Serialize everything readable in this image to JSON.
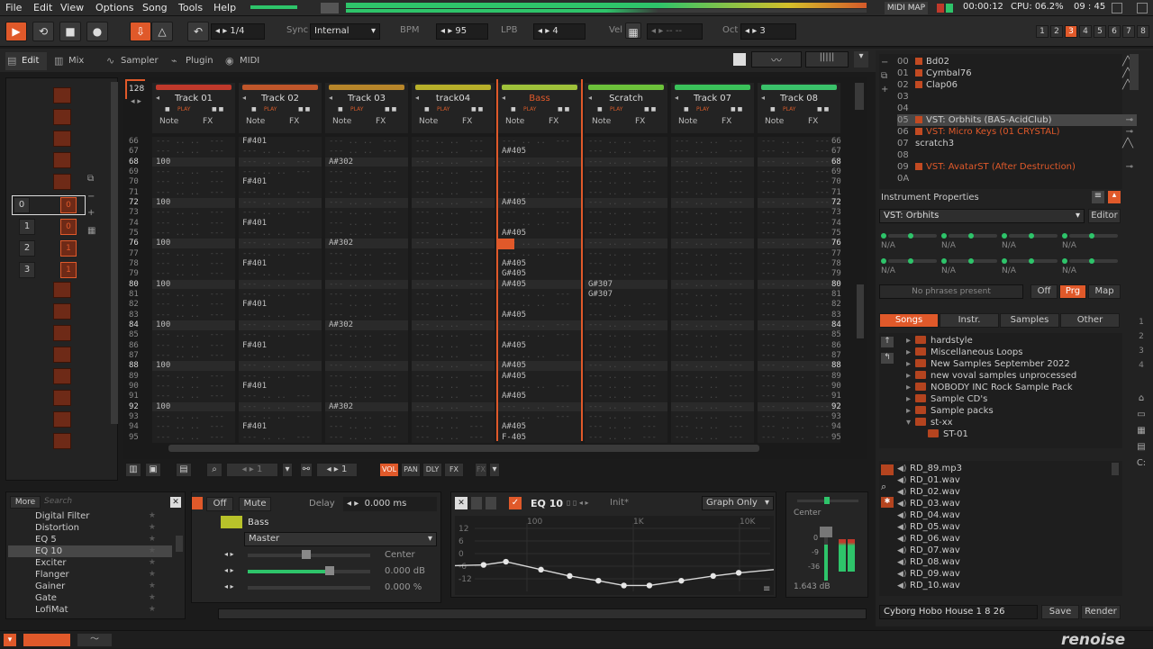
{
  "menu": [
    "File",
    "Edit",
    "View",
    "Options",
    "Song",
    "Tools",
    "Help"
  ],
  "topbar": {
    "midi_map": "MIDI MAP",
    "time": "00:00:12",
    "cpu": "CPU: 06.2%",
    "clock": "09 : 45"
  },
  "toolbar": {
    "pattern_step": "1/4",
    "sync_label": "Sync",
    "sync_value": "Internal",
    "bpm_label": "BPM",
    "bpm_value": "95",
    "lpb_label": "LPB",
    "lpb_value": "4",
    "vel_label": "Vel",
    "vel_value": "-- --",
    "oct_label": "Oct",
    "oct_value": "3",
    "octave_keys": [
      "1",
      "2",
      "3",
      "4",
      "5",
      "6",
      "7",
      "8"
    ]
  },
  "tabs": [
    {
      "label": "Edit",
      "icon": "edit-icon"
    },
    {
      "label": "Mix",
      "icon": "mix-icon"
    },
    {
      "label": "Sampler",
      "icon": "waveform-icon"
    },
    {
      "label": "Plugin",
      "icon": "plugin-icon"
    },
    {
      "label": "MIDI",
      "icon": "midi-icon"
    }
  ],
  "sequencer": {
    "lines": "128",
    "rows": [
      "0",
      "1",
      "2",
      "3"
    ],
    "seq_values": [
      "0",
      "0",
      "1",
      "1"
    ]
  },
  "tracks": [
    {
      "name": "Track 01",
      "color": "#c0392b",
      "play": "PLAY",
      "col1": "Note",
      "col2": "FX"
    },
    {
      "name": "Track 02",
      "color": "#c0562a",
      "play": "PLAY",
      "col1": "Note",
      "col2": "FX"
    },
    {
      "name": "Track 03",
      "color": "#b8862a",
      "play": "PLAY",
      "col1": "Note",
      "col2": "FX"
    },
    {
      "name": "track04",
      "color": "#b8b02a",
      "play": "PLAY",
      "col1": "Note",
      "col2": "FX"
    },
    {
      "name": "Bass",
      "color": "#9fc23a",
      "play": "PLAY",
      "col1": "Note",
      "col2": "FX"
    },
    {
      "name": "Scratch",
      "color": "#6cc23a",
      "play": "PLAY",
      "col1": "Note",
      "col2": "FX"
    },
    {
      "name": "Track 07",
      "color": "#3ac25a",
      "play": "PLAY",
      "col1": "Note",
      "col2": "FX"
    },
    {
      "name": "Track 08",
      "color": "#3ac26a",
      "play": "PLAY",
      "col1": "Note",
      "col2": "FX"
    }
  ],
  "row_numbers": [
    "66",
    "67",
    "68",
    "69",
    "70",
    "71",
    "72",
    "73",
    "74",
    "75",
    "76",
    "77",
    "78",
    "79",
    "80",
    "81",
    "82",
    "83",
    "84",
    "85",
    "86",
    "87",
    "88",
    "89",
    "90",
    "91",
    "92",
    "93",
    "94",
    "95"
  ],
  "pattern_notes": {
    "t1": {
      "68": "100",
      "72": "100",
      "76": "100",
      "80": "100",
      "84": "100",
      "88": "100",
      "92": "100"
    },
    "t2": {
      "66": "F#401",
      "70": "F#401",
      "74": "F#401",
      "78": "F#401",
      "82": "F#401",
      "86": "F#401",
      "90": "F#401",
      "94": "F#401"
    },
    "t3": {
      "68": "A#302",
      "76": "A#302",
      "84": "A#302",
      "92": "A#302"
    },
    "t5": {
      "67": "A#405",
      "72": "A#405",
      "75": "A#405",
      "78": "A#405",
      "79": "G#405",
      "80": "A#405",
      "83": "A#405",
      "86": "A#405",
      "88": "A#405",
      "89": "A#405",
      "91": "A#405",
      "94": "A#405",
      "95": "F-405"
    },
    "t6": {
      "80": "G#307",
      "81": "G#307"
    }
  },
  "lower_bar": {
    "step": "1",
    "edit_step": "1",
    "btns": [
      "VOL",
      "PAN",
      "DLY",
      "FX"
    ]
  },
  "instruments": [
    {
      "num": "00",
      "name": "Bd02",
      "sw": true
    },
    {
      "num": "01",
      "name": "Cymbal76",
      "sw": true
    },
    {
      "num": "02",
      "name": "Clap06",
      "sw": true
    },
    {
      "num": "03",
      "name": "",
      "sw": false
    },
    {
      "num": "04",
      "name": "",
      "sw": false
    },
    {
      "num": "05",
      "name": "VST: Orbhits (BAS-AcidClub)",
      "sw": true
    },
    {
      "num": "06",
      "name": "VST: Micro Keys (01 CRYSTAL)",
      "sw": true
    },
    {
      "num": "07",
      "name": "scratch3",
      "sw": false
    },
    {
      "num": "08",
      "name": "",
      "sw": false
    },
    {
      "num": "09",
      "name": "VST: AvatarST (After Destruction)",
      "sw": true
    },
    {
      "num": "0A",
      "name": "",
      "sw": false
    }
  ],
  "instrument_properties": {
    "title": "Instrument Properties",
    "selected": "VST: Orbhits",
    "editor": "Editor",
    "na": "N/A",
    "phrases": "No phrases present",
    "off": "Off",
    "prg": "Prg",
    "map": "Map"
  },
  "browser_tabs": [
    "Songs",
    "Instr.",
    "Samples",
    "Other"
  ],
  "browser_folders": [
    "hardstyle",
    "Miscellaneous Loops",
    "New Samples September 2022",
    "new voval samples unprocessed",
    "NOBODY INC Rock Sample Pack",
    "Sample CD's",
    "Sample packs",
    "st-xx",
    "ST-01"
  ],
  "files": [
    "RD_89.mp3",
    "RD_01.wav",
    "RD_02.wav",
    "RD_03.wav",
    "RD_04.wav",
    "RD_05.wav",
    "RD_06.wav",
    "RD_07.wav",
    "RD_08.wav",
    "RD_09.wav",
    "RD_10.wav"
  ],
  "song_name": "Cyborg Hobo House 1 8 26",
  "save": "Save",
  "render": "Render",
  "dsp": {
    "more": "More",
    "search": "Search",
    "items": [
      "Digital Filter",
      "Distortion",
      "EQ 5",
      "EQ 10",
      "Exciter",
      "Flanger",
      "Gainer",
      "Gate",
      "LofiMat"
    ]
  },
  "device": {
    "off": "Off",
    "mute": "Mute",
    "delay_label": "Delay",
    "delay_value": "0.000 ms",
    "name": "Bass",
    "routing": "Master",
    "pan": "Center",
    "vol": "0.000 dB",
    "width": "0.000 %"
  },
  "eq": {
    "title": "EQ 10",
    "preset": "Init*",
    "mode": "Graph Only",
    "ylabels": [
      "12",
      "6",
      "0",
      "-6",
      "-12"
    ],
    "xlabels": [
      "100",
      "1K",
      "10K"
    ],
    "points": [
      [
        0.09,
        0.62
      ],
      [
        0.16,
        0.58
      ],
      [
        0.27,
        0.68
      ],
      [
        0.36,
        0.76
      ],
      [
        0.45,
        0.82
      ],
      [
        0.53,
        0.88
      ],
      [
        0.61,
        0.88
      ],
      [
        0.71,
        0.82
      ],
      [
        0.81,
        0.76
      ],
      [
        0.89,
        0.72
      ]
    ]
  },
  "mixer": {
    "pan": "Center",
    "db": "1.643 dB",
    "scale": [
      "0",
      "-9",
      "-36"
    ]
  },
  "logo": "renoise"
}
